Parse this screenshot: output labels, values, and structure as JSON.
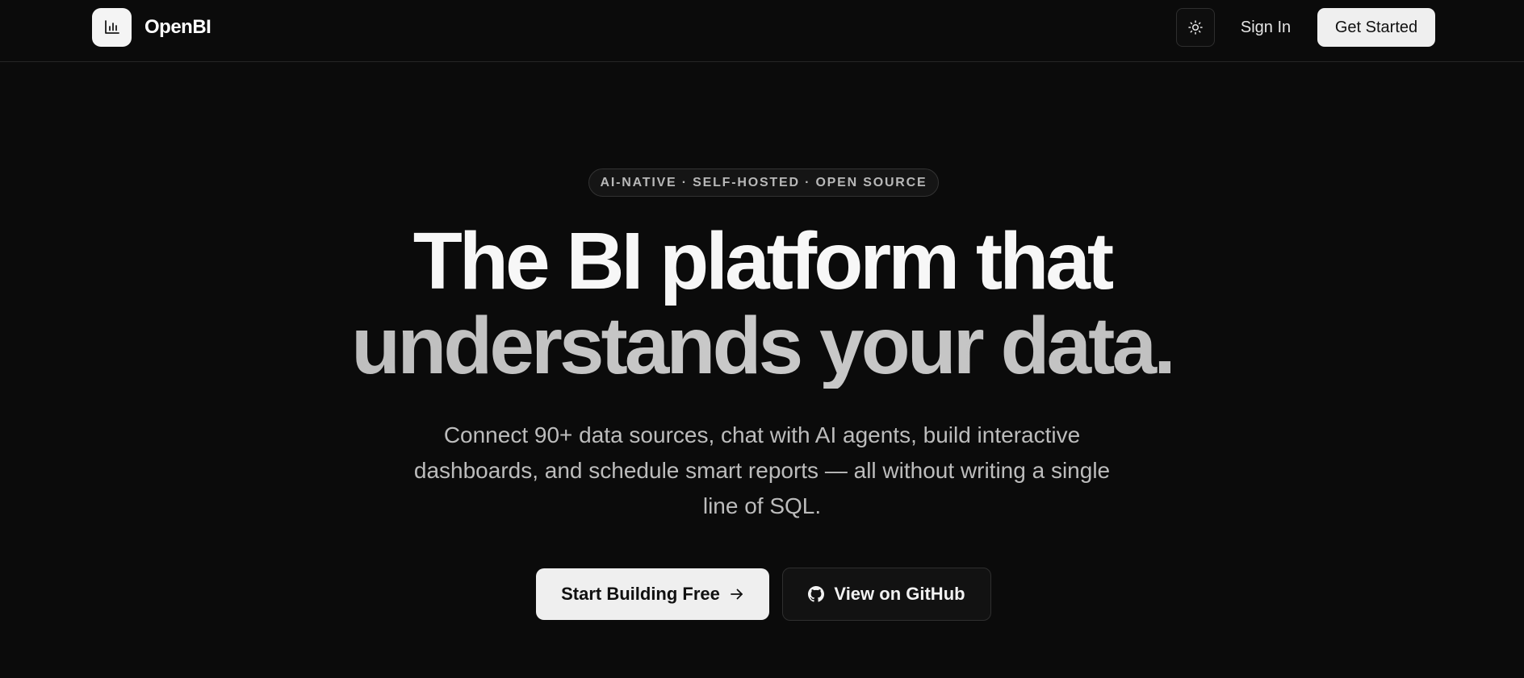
{
  "header": {
    "brand_name": "OpenBI",
    "logo_icon": "bar-chart-icon",
    "theme_toggle_icon": "sun-icon",
    "sign_in_label": "Sign In",
    "get_started_label": "Get Started"
  },
  "hero": {
    "badge_text": "AI-NATIVE · SELF-HOSTED · OPEN SOURCE",
    "headline_line1": "The BI platform that",
    "headline_line2": "understands your data.",
    "subtitle": "Connect 90+ data sources, chat with AI agents, build interactive dashboards, and schedule smart reports — all without writing a single line of SQL.",
    "primary_cta_label": "Start Building Free",
    "primary_cta_icon": "arrow-right-icon",
    "secondary_cta_label": "View on GitHub",
    "secondary_cta_icon": "github-icon"
  },
  "colors": {
    "background": "#0b0b0b",
    "primary_button": "#efefef",
    "secondary_button": "#121212",
    "border": "#262626"
  }
}
